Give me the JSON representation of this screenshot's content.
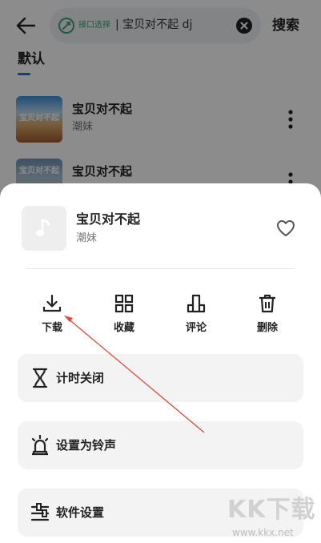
{
  "header": {
    "back_icon": "arrow-left-icon",
    "search": {
      "api_label": "接口选择",
      "query": "| 宝贝对不起 dj",
      "clear_icon": "clear-circle-icon"
    },
    "search_button": "搜索"
  },
  "tabs": [
    {
      "label": "默认",
      "active": true
    }
  ],
  "results": [
    {
      "title": "宝贝对不起",
      "artist": "潮妹",
      "cover_text": "宝贝对不起"
    },
    {
      "title": "宝贝对不起",
      "artist": "",
      "cover_text": "宝贝对不起"
    }
  ],
  "sheet": {
    "song_title": "宝贝对不起",
    "artist": "潮妹",
    "actions": [
      {
        "label": "下载",
        "icon": "download-icon"
      },
      {
        "label": "收藏",
        "icon": "collect-grid-icon"
      },
      {
        "label": "评论",
        "icon": "comment-icon"
      },
      {
        "label": "删除",
        "icon": "trash-icon"
      }
    ],
    "menu": [
      {
        "label": "计时关闭",
        "icon": "hourglass-icon"
      },
      {
        "label": "设置为铃声",
        "icon": "alarm-bell-icon"
      },
      {
        "label": "软件设置",
        "icon": "settings-sliders-icon"
      }
    ]
  },
  "watermark": {
    "main": "KK下载",
    "url": "www.kkx.net"
  },
  "colors": {
    "accent": "#1a73e8",
    "api_green": "#3aa676",
    "annotation_arrow": "#e0483a",
    "overlay": "rgba(0,0,0,0.45)"
  }
}
